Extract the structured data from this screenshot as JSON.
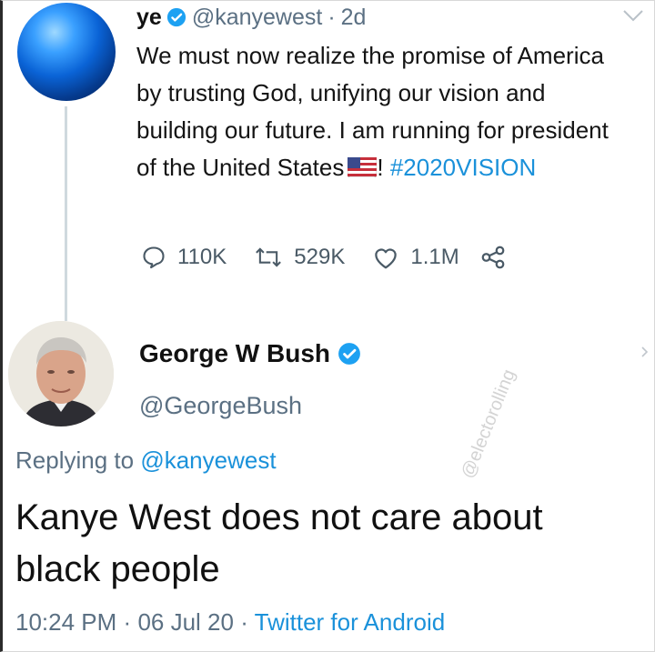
{
  "tweet1": {
    "display_name": "ye",
    "handle": "@kanyewest",
    "time_sep": "·",
    "time": "2d",
    "text_before_flag": "We must now realize the promise of America by trusting God, unifying our vision and building our future. I am running for president of the United States",
    "text_after_flag": "!",
    "hashtag": "#2020VISION",
    "replies": "110K",
    "retweets": "529K",
    "likes": "1.1M"
  },
  "tweet2": {
    "display_name": "George W Bush",
    "handle": "@GeorgeBush",
    "replying_prefix": "Replying to",
    "replying_to": "@kanyewest",
    "text": "Kanye West does not care about black people",
    "time": "10:24 PM",
    "sep1": "·",
    "date": "06 Jul 20",
    "sep2": "·",
    "source": "Twitter for Android"
  },
  "watermark": "@electorolling",
  "colors": {
    "accent": "#1a91da",
    "muted": "#5b7083",
    "verified": "#1da1f2"
  },
  "icons": [
    "verified-badge-icon",
    "chevron-down-icon",
    "reply-icon",
    "retweet-icon",
    "like-icon",
    "share-icon",
    "us-flag-emoji",
    "chevron-right-icon"
  ]
}
